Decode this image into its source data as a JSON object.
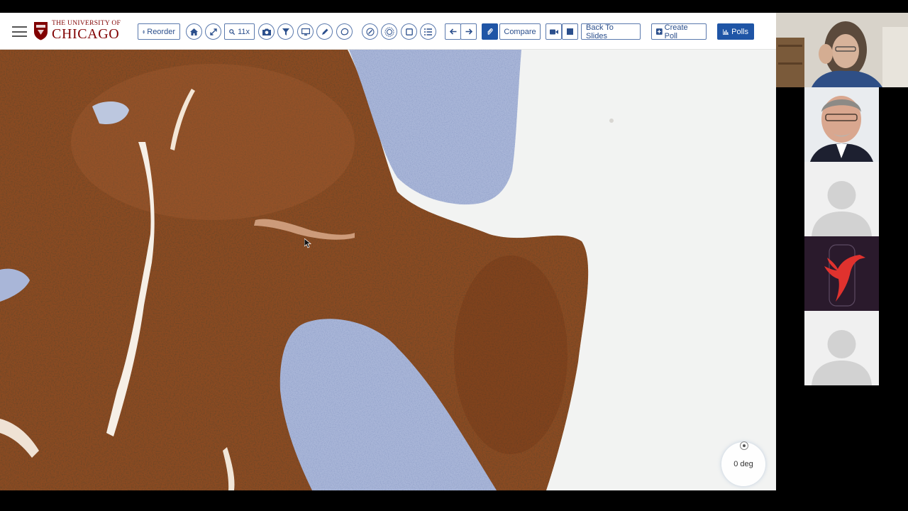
{
  "logo": {
    "line1": "THE UNIVERSITY OF",
    "line2": "CHICAGO"
  },
  "toolbar": {
    "reorder_label": "Reorder",
    "zoom_label": "11x",
    "compare_label": "Compare",
    "back_to_slides_label": "Back To Slides",
    "create_poll_label": "Create Poll",
    "polls_label": "Polls"
  },
  "viewer": {
    "rotation_label": "0 deg"
  },
  "participants": [
    {
      "name": "",
      "video": "on"
    },
    {
      "name": "",
      "video": "on"
    },
    {
      "name": "",
      "video": "off",
      "avatar": "default-avatar-icon"
    },
    {
      "name": "",
      "video": "off",
      "avatar": "bird-logo-icon"
    },
    {
      "name": "",
      "video": "off",
      "avatar": "default-avatar-icon"
    }
  ],
  "colors": {
    "brand_maroon": "#800000",
    "toolbar_blue": "#1f55a6",
    "stain_brown": "#8a4a22",
    "stain_blue": "#9fb0d4"
  }
}
